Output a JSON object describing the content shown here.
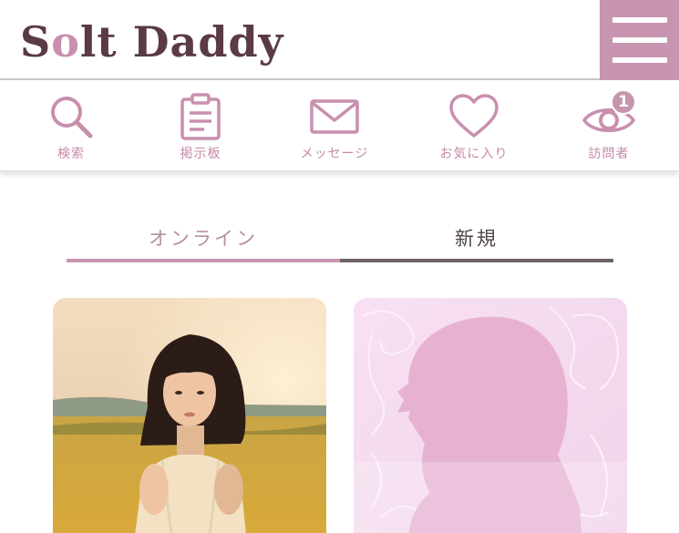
{
  "header": {
    "logo_text": "Solt Daddy",
    "logo_prefix": "S",
    "logo_ring": "o",
    "logo_suffix": "lt Daddy"
  },
  "nav": {
    "items": [
      {
        "label": "検索",
        "icon": "search-icon"
      },
      {
        "label": "掲示板",
        "icon": "clipboard-icon"
      },
      {
        "label": "メッセージ",
        "icon": "mail-icon"
      },
      {
        "label": "お気に入り",
        "icon": "heart-icon"
      },
      {
        "label": "訪問者",
        "icon": "eye-icon",
        "badge": "1"
      }
    ]
  },
  "tabs": [
    {
      "label": "オンライン",
      "active": true
    },
    {
      "label": "新規",
      "active": false
    }
  ],
  "profiles": [
    {
      "type": "photo"
    },
    {
      "type": "placeholder-silhouette"
    }
  ],
  "colors": {
    "accent": "#c795b0",
    "icon": "#c98fae",
    "logo": "#5a3a45",
    "tab_active_line": "#c795b0",
    "tab_inactive_line": "#6e6266"
  }
}
